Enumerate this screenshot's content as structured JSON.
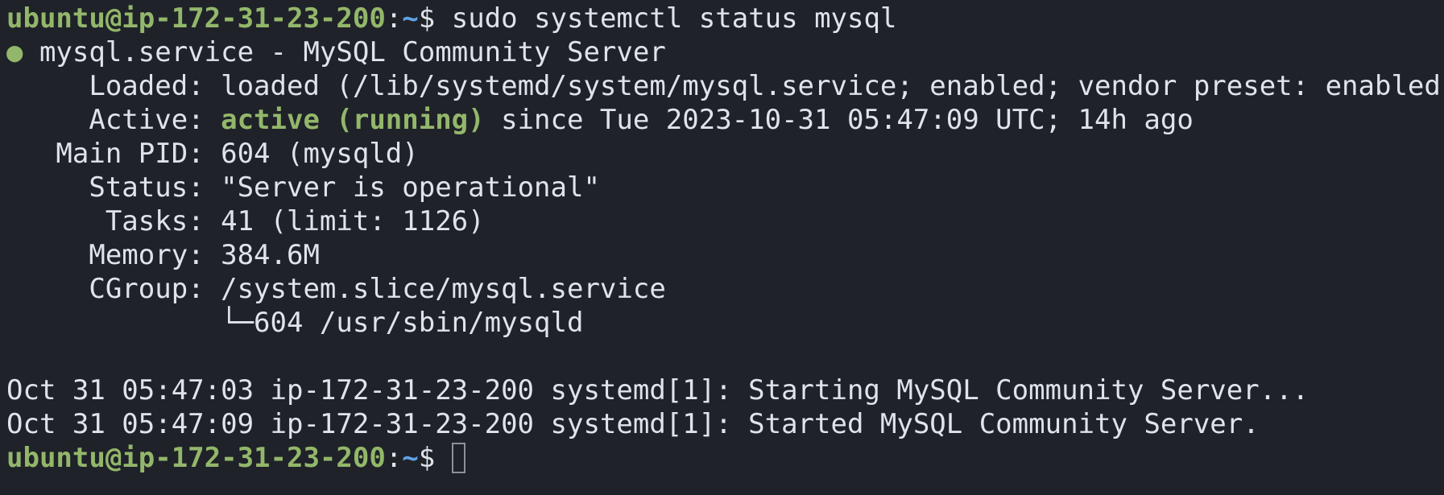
{
  "prompt": {
    "user_host": "ubuntu@ip-172-31-23-200",
    "separator": ":",
    "cwd": "~",
    "symbol": "$ "
  },
  "command": "sudo systemctl status mysql",
  "status": {
    "bullet": "●",
    "title": " mysql.service - MySQL Community Server",
    "fields": {
      "loaded_key": "     Loaded: ",
      "loaded_value": "loaded (/lib/systemd/system/mysql.service; enabled; vendor preset: enabled)",
      "active_key": "     Active: ",
      "active_state": "active (running)",
      "active_since": " since Tue 2023-10-31 05:47:09 UTC; 14h ago",
      "pid_key": "   Main PID: ",
      "pid_value": "604 (mysqld)",
      "status_key": "     Status: ",
      "status_value": "\"Server is operational\"",
      "tasks_key": "      Tasks: ",
      "tasks_value": "41 (limit: 1126)",
      "memory_key": "     Memory: ",
      "memory_value": "384.6M",
      "cgroup_key": "     CGroup: ",
      "cgroup_value": "/system.slice/mysql.service",
      "cgroup_child": "             └─604 /usr/sbin/mysqld"
    }
  },
  "log": [
    "Oct 31 05:47:03 ip-172-31-23-200 systemd[1]: Starting MySQL Community Server...",
    "Oct 31 05:47:09 ip-172-31-23-200 systemd[1]: Started MySQL Community Server."
  ],
  "colors": {
    "background": "#1f2229",
    "text": "#dfe3ea",
    "user": "#93b76a",
    "path": "#5fa2e6"
  }
}
